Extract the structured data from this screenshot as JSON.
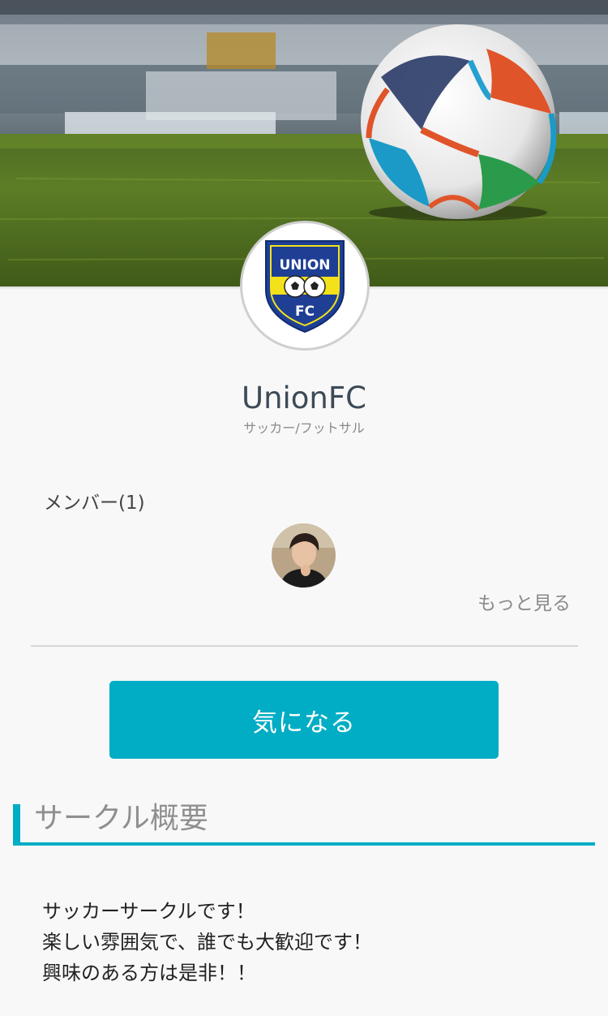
{
  "club": {
    "name": "UnionFC",
    "category": "サッカー/フットサル",
    "logo_text_top": "UNION",
    "logo_text_bottom": "FC"
  },
  "members": {
    "label": "メンバー(1)",
    "see_more": "もっと見る"
  },
  "actions": {
    "interest_button": "気になる"
  },
  "overview": {
    "title": "サークル概要",
    "lines": [
      "サッカーサークルです！",
      "楽しい雰囲気で、誰でも大歓迎です！",
      "興味のある方は是非！！"
    ]
  },
  "colors": {
    "accent": "#00adc4",
    "title": "#3d4a57",
    "logo_blue": "#1f3f95",
    "logo_yellow": "#f3e21a"
  }
}
